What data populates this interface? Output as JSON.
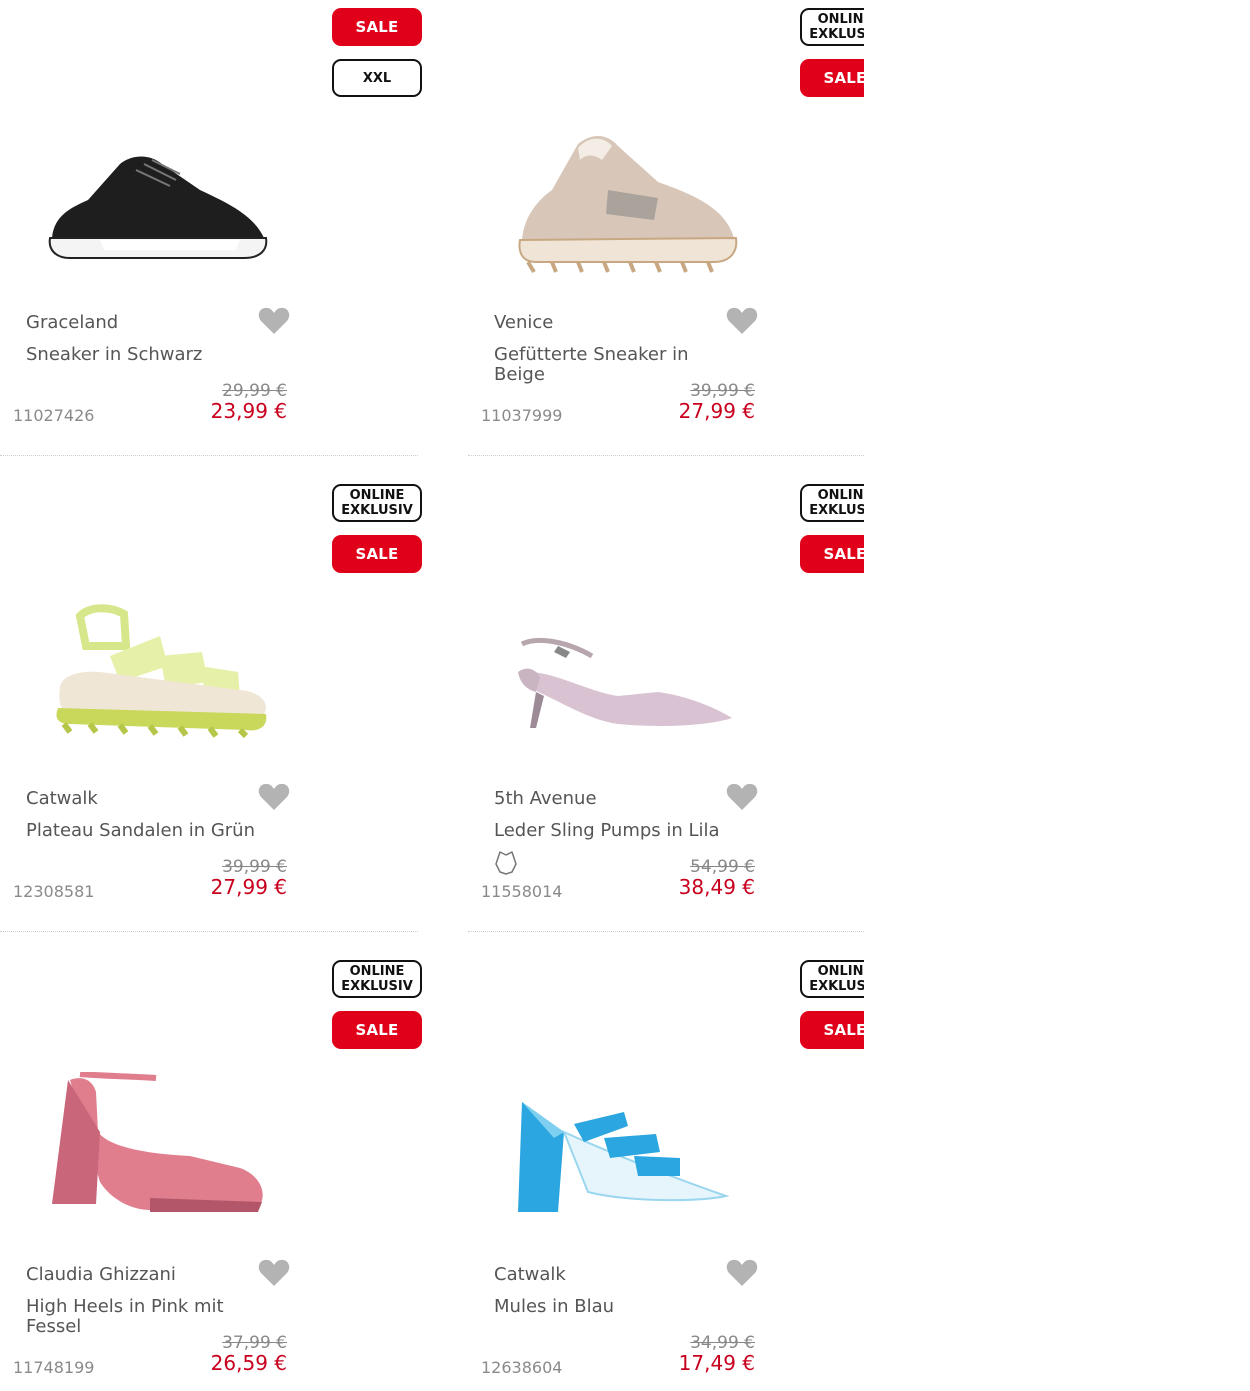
{
  "products": [
    {
      "badges": [
        "SALE",
        "XXL"
      ],
      "badge_types": [
        "sale",
        "xxl"
      ],
      "brand": "Graceland",
      "name": "Sneaker in Schwarz",
      "old_price": "29,99 €",
      "new_price": "23,99 €",
      "sku": "11027426",
      "image_icon": "black-sneaker-image",
      "shoe_color": "#1e1e1e"
    },
    {
      "badges": [
        "ONLINE\nEXKLUSIV",
        "SALE"
      ],
      "badge_types": [
        "online",
        "sale"
      ],
      "brand": "Venice",
      "name": "Gefütterte Sneaker in Beige",
      "old_price": "39,99 €",
      "new_price": "27,99 €",
      "sku": "11037999",
      "image_icon": "beige-sneaker-image",
      "shoe_color": "#d8c6b8"
    },
    {
      "badges": [
        "ONLINE\nEXKLUSIV",
        "SALE"
      ],
      "badge_types": [
        "online",
        "sale"
      ],
      "brand": "Catwalk",
      "name": "Plateau Sandalen in Grün",
      "old_price": "39,99 €",
      "new_price": "27,99 €",
      "sku": "12308581",
      "image_icon": "green-sandal-image",
      "shoe_color": "#d6e68a"
    },
    {
      "badges": [
        "ONLINE\nEXKLUSIV",
        "SALE"
      ],
      "badge_types": [
        "online",
        "sale"
      ],
      "brand": "5th Avenue",
      "name": "Leder Sling Pumps in Lila",
      "old_price": "54,99 €",
      "new_price": "38,49 €",
      "sku": "11558014",
      "image_icon": "lilac-pump-image",
      "shoe_color": "#d9c3d3",
      "leather_icon": "leather-icon"
    },
    {
      "badges": [
        "ONLINE\nEXKLUSIV",
        "SALE"
      ],
      "badge_types": [
        "online",
        "sale"
      ],
      "brand": "Claudia Ghizzani",
      "name": "High Heels in Pink mit Fessel",
      "old_price": "37,99 €",
      "new_price": "26,59 €",
      "sku": "11748199",
      "image_icon": "pink-heel-image",
      "shoe_color": "#e07e8e"
    },
    {
      "badges": [
        "ONLINE\nEXKLUSIV",
        "SALE"
      ],
      "badge_types": [
        "online",
        "sale"
      ],
      "brand": "Catwalk",
      "name": "Mules in Blau",
      "old_price": "34,99 €",
      "new_price": "17,49 €",
      "sku": "12638604",
      "image_icon": "blue-mule-image",
      "shoe_color": "#2ba6e0"
    }
  ],
  "colors": {
    "sale_red": "#e10019",
    "price_red": "#c8001e",
    "heart_gray": "#b3b3b3"
  }
}
